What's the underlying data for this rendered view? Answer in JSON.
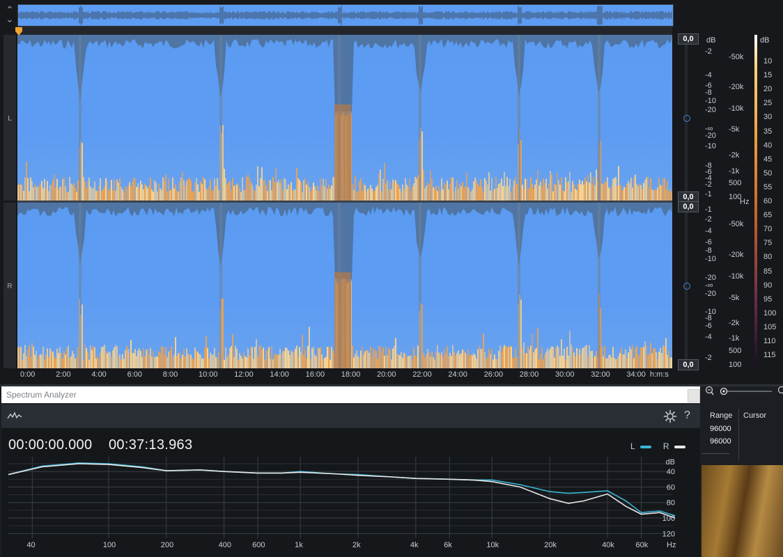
{
  "editor": {
    "channels": [
      {
        "label": "L"
      },
      {
        "label": "R"
      }
    ],
    "zero_badges": [
      "0,0",
      "0,0",
      "0,0",
      "0,0"
    ],
    "db_scale_label": "dB",
    "db_ticks_top": [
      "-2",
      "-4",
      "-6",
      "-8",
      "-10",
      "-20",
      "-∞",
      "-20",
      "-10",
      "-8",
      "-6",
      "-4",
      "-2",
      "-1"
    ],
    "db_ticks_bottom": [
      "-1",
      "-2",
      "-4",
      "-6",
      "-8",
      "-10",
      "-20",
      "-∞",
      "-20",
      "-10",
      "-8",
      "-6",
      "-4",
      "-2",
      "-1"
    ],
    "hz_ticks": [
      "-50k",
      "-20k",
      "-10k",
      "-5k",
      "-2k",
      "-1k",
      "500",
      "100"
    ],
    "hz_unit": "Hz",
    "colorbar_label": "dB",
    "colorbar_ticks": [
      "10",
      "15",
      "20",
      "25",
      "30",
      "35",
      "40",
      "45",
      "50",
      "55",
      "60",
      "65",
      "70",
      "75",
      "80",
      "85",
      "90",
      "95",
      "100",
      "105",
      "110",
      "115"
    ],
    "time_ticks": [
      "0:00",
      "2:00",
      "4:00",
      "6:00",
      "8:00",
      "10:00",
      "12:00",
      "14:00",
      "16:00",
      "18:00",
      "20:00",
      "22:00",
      "24:00",
      "26:00",
      "28:00",
      "30:00",
      "32:00",
      "34:00"
    ],
    "time_unit": "h:m:s"
  },
  "right_panel": {
    "range_label": "Range",
    "cursor_label": "Cursor",
    "range_values": [
      "96000",
      "96000"
    ]
  },
  "dialog": {
    "title": "Spectrum Analyzer",
    "start_time": "00:00:00.000",
    "end_time": "00:37:13.963",
    "legend": [
      {
        "name": "L",
        "color": "#3bb6d6"
      },
      {
        "name": "R",
        "color": "#e8e8e8"
      }
    ]
  },
  "chart_data": {
    "type": "line",
    "xlabel": "Hz",
    "ylabel": "dB",
    "x_scale": "log",
    "x_ticks": [
      40,
      100,
      200,
      400,
      600,
      1000,
      2000,
      4000,
      6000,
      10000,
      20000,
      40000,
      60000
    ],
    "x_tick_labels": [
      "40",
      "100",
      "200",
      "400",
      "600",
      "1k",
      "2k",
      "4k",
      "6k",
      "10k",
      "20k",
      "40k",
      "60k"
    ],
    "y_ticks": [
      40,
      60,
      80,
      100,
      120
    ],
    "y_tick_labels": [
      "40",
      "60",
      "80",
      "100",
      "120"
    ],
    "ylim": [
      21,
      126
    ],
    "xlim": [
      30,
      90000
    ],
    "grid": true,
    "series": [
      {
        "name": "L",
        "color": "#3bb6d6",
        "x": [
          30,
          45,
          70,
          100,
          150,
          200,
          300,
          400,
          600,
          800,
          1000,
          1500,
          2000,
          3000,
          4000,
          6000,
          8000,
          10000,
          14000,
          20000,
          25000,
          30000,
          40000,
          50000,
          60000,
          75000,
          90000
        ],
        "y": [
          44,
          33,
          29,
          30,
          34,
          39,
          38,
          40,
          42,
          42,
          40,
          43,
          44,
          47,
          49,
          50,
          51,
          51,
          57,
          66,
          68,
          67,
          65,
          78,
          93,
          91,
          97
        ]
      },
      {
        "name": "R",
        "color": "#e8e8e8",
        "x": [
          30,
          45,
          70,
          100,
          150,
          200,
          300,
          400,
          600,
          800,
          1000,
          1500,
          2000,
          3000,
          4000,
          6000,
          8000,
          10000,
          14000,
          20000,
          25000,
          30000,
          40000,
          50000,
          60000,
          75000,
          90000
        ],
        "y": [
          44,
          34,
          30,
          31,
          35,
          39,
          38,
          40,
          42,
          42,
          41,
          43,
          45,
          47,
          49,
          50,
          51,
          53,
          60,
          75,
          81,
          78,
          69,
          85,
          95,
          93,
          100
        ]
      }
    ]
  }
}
